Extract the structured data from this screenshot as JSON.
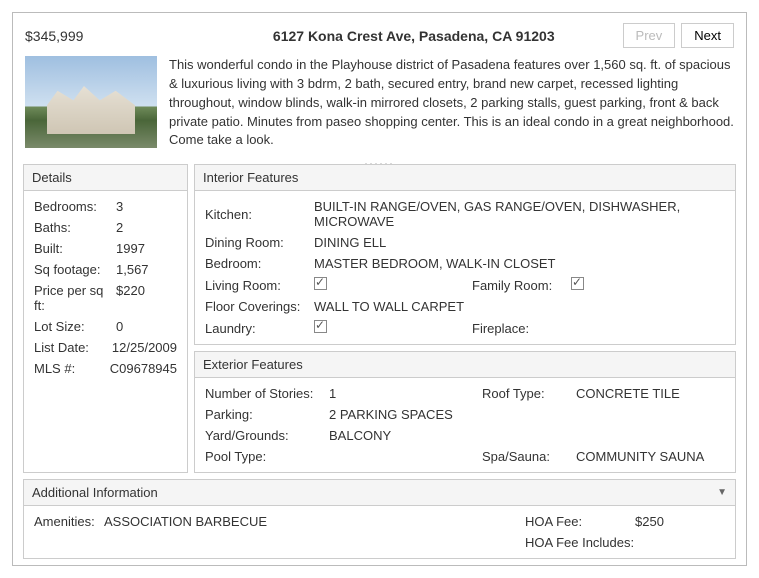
{
  "header": {
    "price": "$345,999",
    "address": "6127 Kona Crest Ave, Pasadena, CA 91203",
    "prev": "Prev",
    "next": "Next"
  },
  "description": "This wonderful condo in the Playhouse district of Pasadena features over 1,560 sq. ft. of spacious & luxurious living with 3 bdrm, 2 bath, secured entry, brand new carpet, recessed lighting throughout, window blinds, walk-in mirrored closets, 2 parking stalls, guest parking, front & back private patio. Minutes from paseo shopping center. This is an ideal condo in a great neighborhood. Come take a look.",
  "details": {
    "title": "Details",
    "bedrooms_l": "Bedrooms:",
    "bedrooms_v": "3",
    "baths_l": "Baths:",
    "baths_v": "2",
    "built_l": "Built:",
    "built_v": "1997",
    "sqft_l": "Sq footage:",
    "sqft_v": "1,567",
    "ppsf_l": "Price per sq ft:",
    "ppsf_v": "$220",
    "lot_l": "Lot Size:",
    "lot_v": "0",
    "list_l": "List Date:",
    "list_v": "12/25/2009",
    "mls_l": "MLS #:",
    "mls_v": "C09678945"
  },
  "interior": {
    "title": "Interior Features",
    "kitchen_l": "Kitchen:",
    "kitchen_v": "BUILT-IN RANGE/OVEN, GAS RANGE/OVEN, DISHWASHER, MICROWAVE",
    "dining_l": "Dining Room:",
    "dining_v": "DINING ELL",
    "bedroom_l": "Bedroom:",
    "bedroom_v": "MASTER BEDROOM, WALK-IN CLOSET",
    "living_l": "Living Room:",
    "family_l": "Family Room:",
    "floor_l": "Floor Coverings:",
    "floor_v": "WALL TO WALL CARPET",
    "laundry_l": "Laundry:",
    "fireplace_l": "Fireplace:"
  },
  "exterior": {
    "title": "Exterior Features",
    "stories_l": "Number of Stories:",
    "stories_v": "1",
    "roof_l": "Roof Type:",
    "roof_v": "CONCRETE TILE",
    "parking_l": "Parking:",
    "parking_v": "2 PARKING SPACES",
    "yard_l": "Yard/Grounds:",
    "yard_v": "BALCONY",
    "pool_l": "Pool Type:",
    "pool_v": "",
    "spa_l": "Spa/Sauna:",
    "spa_v": "COMMUNITY SAUNA"
  },
  "additional": {
    "title": "Additional Information",
    "amen_l": "Amenities:",
    "amen_v": "ASSOCIATION BARBECUE",
    "hoafee_l": "HOA Fee:",
    "hoafee_v": "$250",
    "hoainc_l": "HOA Fee Includes:",
    "hoainc_v": ""
  }
}
